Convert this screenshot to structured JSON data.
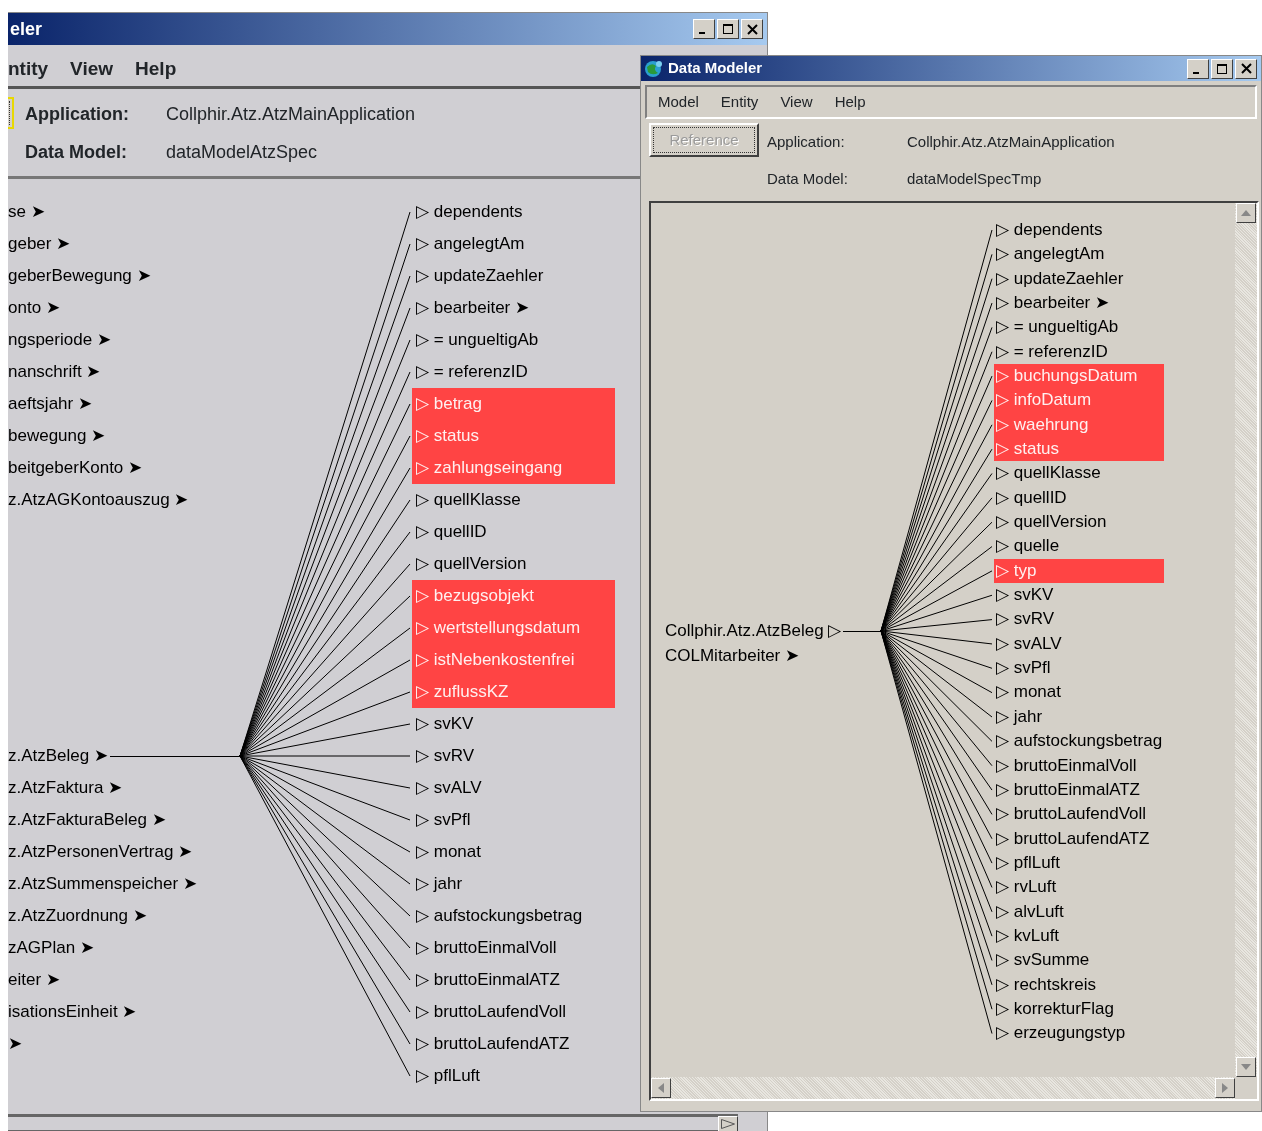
{
  "windows": [
    {
      "title": "eler",
      "menu": [
        "ntity",
        "View",
        "Help"
      ],
      "button": {
        "disabled": false
      },
      "fields": [
        {
          "label": "Application:",
          "value": "Collphir.Atz.AtzMainApplication"
        },
        {
          "label": "Data Model:",
          "value": "dataModelAtzSpec"
        }
      ],
      "diagram": {
        "sources_before": [
          {
            "label": "se ➤"
          },
          {
            "label": "geber ➤"
          },
          {
            "label": "geberBewegung ➤"
          },
          {
            "label": "onto ➤"
          },
          {
            "label": "ngsperiode ➤"
          },
          {
            "label": "nanschrift ➤"
          },
          {
            "label": "aeftsjahr ➤"
          },
          {
            "label": "bewegung ➤"
          },
          {
            "label": "beitgeberKonto ➤"
          },
          {
            "label": "z.AtzAGKontoauszug ➤"
          }
        ],
        "root": {
          "label": "z.AtzBeleg ➤"
        },
        "sources_after": [
          {
            "label": "z.AtzFaktura ➤"
          },
          {
            "label": "z.AtzFakturaBeleg ➤"
          },
          {
            "label": "z.AtzPersonenVertrag ➤"
          },
          {
            "label": "z.AtzSummenspeicher ➤"
          },
          {
            "label": "z.AtzZuordnung ➤"
          },
          {
            "label": "zAGPlan ➤"
          },
          {
            "label": "eiter ➤"
          },
          {
            "label": "isationsEinheit ➤"
          },
          {
            "label": "➤"
          }
        ],
        "targets": [
          {
            "label": "▷ dependents",
            "highlighted": false
          },
          {
            "label": "▷ angelegtAm",
            "highlighted": false
          },
          {
            "label": "▷ updateZaehler",
            "highlighted": false
          },
          {
            "label": "▷ bearbeiter ➤",
            "highlighted": false
          },
          {
            "label": "▷ = ungueltigAb",
            "highlighted": false
          },
          {
            "label": "▷ = referenzID",
            "highlighted": false
          },
          {
            "label": "▷ betrag",
            "highlighted": true
          },
          {
            "label": "▷ status",
            "highlighted": true
          },
          {
            "label": "▷ zahlungseingang",
            "highlighted": true
          },
          {
            "label": "▷ quellKlasse",
            "highlighted": false
          },
          {
            "label": "▷ quellID",
            "highlighted": false
          },
          {
            "label": "▷ quellVersion",
            "highlighted": false
          },
          {
            "label": "▷ bezugsobjekt",
            "highlighted": true
          },
          {
            "label": "▷ wertstellungsdatum",
            "highlighted": true
          },
          {
            "label": "▷ istNebenkostenfrei",
            "highlighted": true
          },
          {
            "label": "▷ zuflussKZ",
            "highlighted": true
          },
          {
            "label": "▷ svKV",
            "highlighted": false
          },
          {
            "label": "▷ svRV",
            "highlighted": false
          },
          {
            "label": "▷ svALV",
            "highlighted": false
          },
          {
            "label": "▷ svPfl",
            "highlighted": false
          },
          {
            "label": "▷ monat",
            "highlighted": false
          },
          {
            "label": "▷ jahr",
            "highlighted": false
          },
          {
            "label": "▷ aufstockungsbetrag",
            "highlighted": false
          },
          {
            "label": "▷ bruttoEinmalVoll",
            "highlighted": false
          },
          {
            "label": "▷ bruttoEinmalATZ",
            "highlighted": false
          },
          {
            "label": "▷ bruttoLaufendVoll",
            "highlighted": false
          },
          {
            "label": "▷ bruttoLaufendATZ",
            "highlighted": false
          },
          {
            "label": "▷ pflLuft",
            "highlighted": false
          }
        ]
      }
    },
    {
      "title": "Data Modeler",
      "menu": [
        "Model",
        "Entity",
        "View",
        "Help"
      ],
      "button": {
        "label": "Reference",
        "disabled": true
      },
      "fields": [
        {
          "label": "Application:",
          "value": "Collphir.Atz.AtzMainApplication"
        },
        {
          "label": "Data Model:",
          "value": "dataModelSpecTmp"
        }
      ],
      "diagram": {
        "root": {
          "label": "Collphir.Atz.AtzBeleg ▷"
        },
        "sources_after": [
          {
            "label": "COLMitarbeiter ➤"
          }
        ],
        "targets": [
          {
            "label": "▷ dependents",
            "highlighted": false
          },
          {
            "label": "▷ angelegtAm",
            "highlighted": false
          },
          {
            "label": "▷ updateZaehler",
            "highlighted": false
          },
          {
            "label": "▷ bearbeiter ➤",
            "highlighted": false
          },
          {
            "label": "▷ = ungueltigAb",
            "highlighted": false
          },
          {
            "label": "▷ = referenzID",
            "highlighted": false
          },
          {
            "label": "▷ buchungsDatum",
            "highlighted": true
          },
          {
            "label": "▷ infoDatum",
            "highlighted": true
          },
          {
            "label": "▷ waehrung",
            "highlighted": true
          },
          {
            "label": "▷ status",
            "highlighted": true
          },
          {
            "label": "▷ quellKlasse",
            "highlighted": false
          },
          {
            "label": "▷ quellID",
            "highlighted": false
          },
          {
            "label": "▷ quellVersion",
            "highlighted": false
          },
          {
            "label": "▷ quelle",
            "highlighted": false
          },
          {
            "label": "▷ typ",
            "highlighted": true
          },
          {
            "label": "▷ svKV",
            "highlighted": false
          },
          {
            "label": "▷ svRV",
            "highlighted": false
          },
          {
            "label": "▷ svALV",
            "highlighted": false
          },
          {
            "label": "▷ svPfl",
            "highlighted": false
          },
          {
            "label": "▷ monat",
            "highlighted": false
          },
          {
            "label": "▷ jahr",
            "highlighted": false
          },
          {
            "label": "▷ aufstockungsbetrag",
            "highlighted": false
          },
          {
            "label": "▷ bruttoEinmalVoll",
            "highlighted": false
          },
          {
            "label": "▷ bruttoEinmalATZ",
            "highlighted": false
          },
          {
            "label": "▷ bruttoLaufendVoll",
            "highlighted": false
          },
          {
            "label": "▷ bruttoLaufendATZ",
            "highlighted": false
          },
          {
            "label": "▷ pflLuft",
            "highlighted": false
          },
          {
            "label": "▷ rvLuft",
            "highlighted": false
          },
          {
            "label": "▷ alvLuft",
            "highlighted": false
          },
          {
            "label": "▷ kvLuft",
            "highlighted": false
          },
          {
            "label": "▷ svSumme",
            "highlighted": false
          },
          {
            "label": "▷ rechtskreis",
            "highlighted": false
          },
          {
            "label": "▷ korrekturFlag",
            "highlighted": false
          },
          {
            "label": "▷ erzeugungstyp",
            "highlighted": false
          }
        ]
      }
    }
  ]
}
